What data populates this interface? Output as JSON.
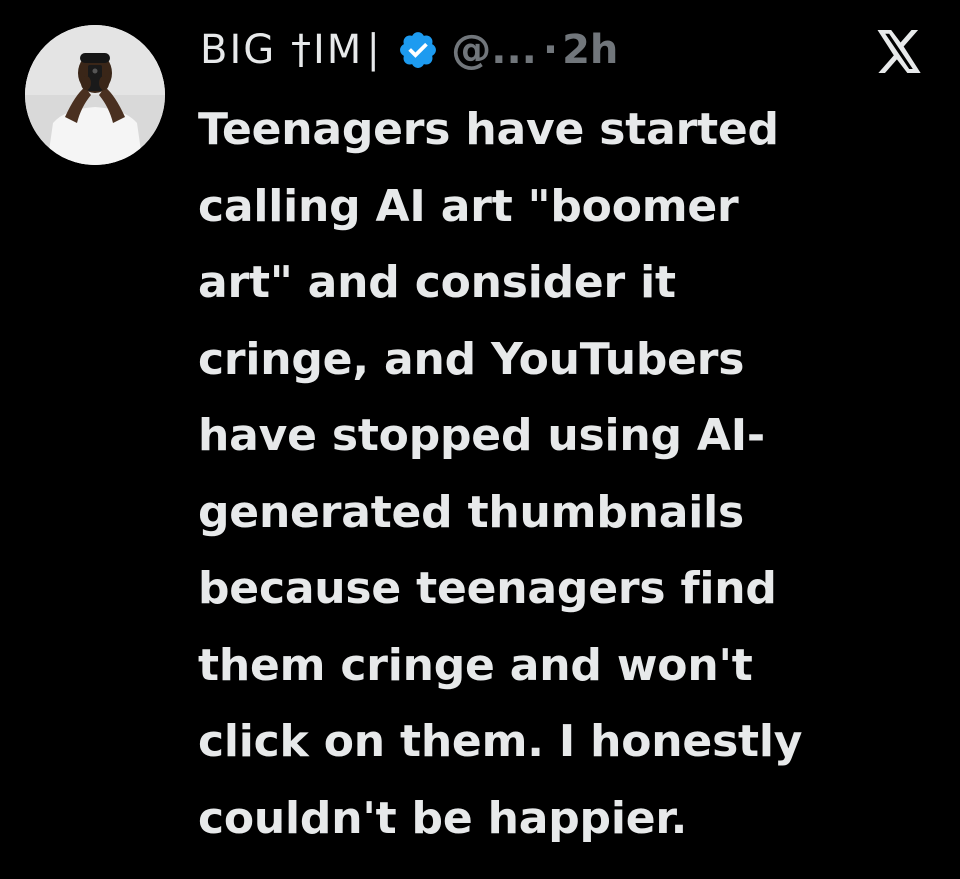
{
  "tweet": {
    "author": {
      "display_name": "BIG †IM∣",
      "handle": "@...",
      "verified_icon": "verified-badge-icon",
      "avatar": "profile-avatar"
    },
    "separator": "·",
    "timestamp": "2h",
    "platform_logo": "x-logo-icon",
    "text": "Teenagers have started\ncalling AI art \"boomer\nart\" and consider it\ncringe, and YouTubers\nhave stopped using AI-\ngenerated thumbnails\nbecause teenagers find\nthem cringe and won't\nclick on them. I honestly\ncouldn't be happier."
  },
  "colors": {
    "background": "#000000",
    "primary_text": "#e7e9ea",
    "secondary_text": "#71767b",
    "verified_blue": "#1d9bf0"
  }
}
